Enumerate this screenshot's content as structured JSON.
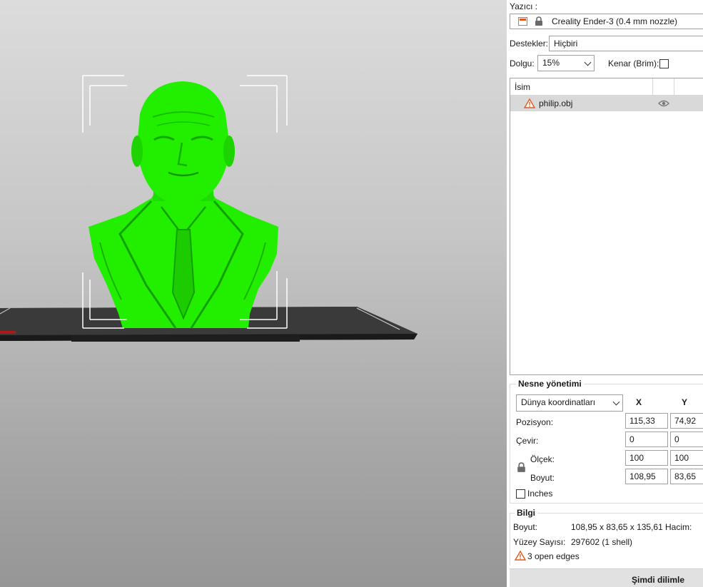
{
  "colors": {
    "model": "#22ee00",
    "model_shade": "#16b800",
    "bed": "#2e2e2e",
    "selection_corners": "#ffffff",
    "warning": "#e05a1c"
  },
  "viewport": {
    "object_name": "philip.obj"
  },
  "sidebar": {
    "printer_label": "Yazıcı :",
    "printer_icon": "printer-profile-icon",
    "printer_lock_icon": "lock-icon",
    "printer_value": "Creality Ender-3 (0.4 mm nozzle)",
    "supports_label": "Destekler:",
    "supports_value": "Hiçbiri",
    "infill_label": "Dolgu:",
    "infill_value": "15%",
    "brim_label": "Kenar (Brim):",
    "brim_checked": false,
    "objects_list": {
      "header_name": "İsim",
      "items": [
        {
          "name": "philip.obj",
          "icon": "warning-icon",
          "visibility_icon": "eye-icon"
        }
      ]
    },
    "object_manipulation": {
      "title": "Nesne yönetimi",
      "coord_system": "Dünya koordinatları",
      "col_x": "X",
      "col_y": "Y",
      "position_label": "Pozisyon:",
      "position_x": "115,33",
      "position_y": "74,92",
      "rotate_label": "Çevir:",
      "rotate_x": "0",
      "rotate_y": "0",
      "scale_label": "Ölçek:",
      "scale_x": "100",
      "scale_y": "100",
      "size_label": "Boyut:",
      "size_x": "108,95",
      "size_y": "83,65",
      "inches_label": "Inches",
      "inches_checked": false
    },
    "info": {
      "title": "Bilgi",
      "size_label": "Boyut:",
      "size_value": "108,95 x 83,65 x 135,61",
      "volume_label": "Hacim:",
      "facets_label": "Yüzey Sayısı:",
      "facets_value": "297602 (1 shell)",
      "open_edges": "3 open edges"
    },
    "slice_button": "Şimdi dilimle"
  }
}
